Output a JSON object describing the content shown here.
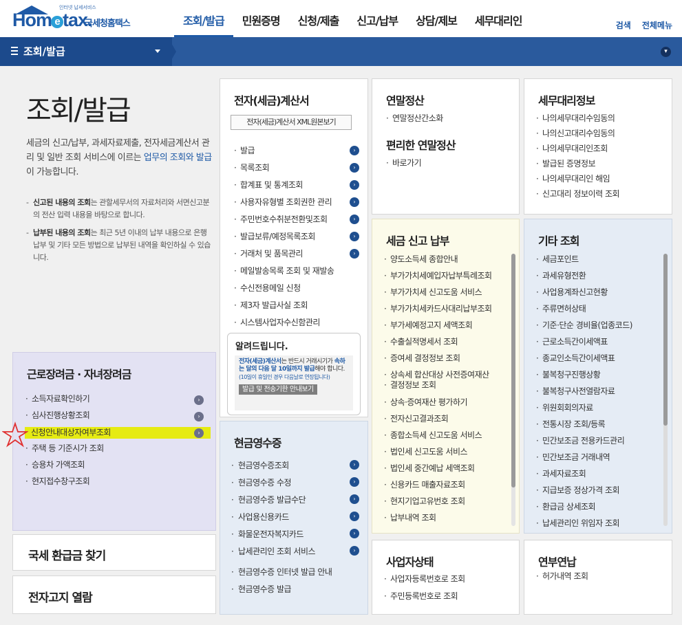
{
  "header": {
    "logo_small": "인터넷 납세서비스",
    "logo_text_a": "Hom",
    "logo_text_e": "e",
    "logo_text_b": "tax.",
    "logo_ko": "국세청홈택스",
    "nav": [
      "조회/발급",
      "민원증명",
      "신청/제출",
      "신고/납부",
      "상담/제보",
      "세무대리인"
    ],
    "util": [
      "검색",
      "전체메뉴"
    ]
  },
  "bar": {
    "menu_label": "조회/발급"
  },
  "intro": {
    "title": "조회/발급",
    "desc_a": "세금의 신고/납부, 과세자료제출, 전자세금계산서 관리 및 일반 조회 서비스에 이르는 ",
    "desc_hl": "업무의 조회와 발급",
    "desc_b": "이 가능합니다.",
    "note1_b": "신고된 내용의 조회",
    "note1": "는 관할세무서의 자료처리와 서면신고분의 전산 입력 내용을 바탕으로 합니다.",
    "note2_b": "납부된 내용의 조회",
    "note2": "는 최근 5년 이내의 납부 내용으로 은행 납부 및 기타 모든 방법으로 납부된 내역을 확인하실 수 있습니다."
  },
  "einvoice": {
    "title": "전자(세금)계산서",
    "xml_button": "전자(세금)계산서 XML원본보기",
    "items": [
      "발급",
      "목록조회",
      "합계표 및 통계조회",
      "사용자유형별 조회권한 관리",
      "주민번호수취분전환및조회",
      "발급보류/예정목록조회",
      "거래처 및 품목관리",
      "메일발송목록 조회 및 재발송",
      "수신전용메일 신청",
      "제3자 발급사실 조회",
      "시스템사업자수신함관리"
    ],
    "notice_title": "알려드립니다.",
    "notice_blue": "전자(세금)계산서",
    "notice_text1": "는 반드시 거래시기가 ",
    "notice_blue2": "속하는 달의 다음 달 10일까지 발급",
    "notice_text2": "해야 합니다.",
    "notice_small": "(10일이 휴일인 경우 다음날로 연장됩니다)",
    "notice_button": "발급 및 전송기한 안내보기"
  },
  "yearend": {
    "title": "연말정산",
    "items": [
      "연말정산간소화"
    ],
    "title2": "편리한 연말정산",
    "items2": [
      "바로가기"
    ]
  },
  "agent": {
    "title": "세무대리정보",
    "items": [
      "나의세무대리수임동의",
      "나의신고대리수임동의",
      "나의세무대리인조회",
      "발급된 증명정보",
      "나의세무대리인 해임",
      "신고대리 정보이력 조회"
    ]
  },
  "taxpay": {
    "title": "세금 신고 납부",
    "items": [
      "양도소득세 종합안내",
      "부가가치세예입자납부특례조회",
      "부가가치세 신고도움 서비스",
      "부가가치세카드사대리납부조회",
      "부가세예정고지 세액조회",
      "수출실적명세서 조회",
      "증여세 결정정보 조회",
      "상속세 합산대상 사전증여재산",
      "결정정보 조회",
      "상속·증여재산 평가하기",
      "전자신고결과조회",
      "종합소득세 신고도움 서비스",
      "법인세 신고도움 서비스",
      "법인세 중간예납 세액조회",
      "신용카드 매출자료조회",
      "현지기업고유번호 조회",
      "납부내역 조회"
    ]
  },
  "other": {
    "title": "기타 조회",
    "items": [
      "세금포인트",
      "과세유형전환",
      "사업용계좌신고현황",
      "주류면허상태",
      "기준·단순 경비율(업종코드)",
      "근로소득간이세액표",
      "종교인소득간이세액표",
      "불복청구진행상황",
      "불복청구사전열람자료",
      "위원회회의자료",
      "전통시장 조회/등록",
      "민간보조금 전용카드관리",
      "민간보조금 거래내역",
      "과세자료조회",
      "지급보증 정상가격 조회",
      "환급금 상세조회",
      "납세관리인 위임자 조회"
    ]
  },
  "eitc": {
    "title": "근로장려금 · 자녀장려금",
    "items": [
      "소득자료확인하기",
      "심사진행상황조회",
      "신청안내대상자여부조회",
      "주택 등 기준시가 조회",
      "승용차 가액조회",
      "현지접수창구조회"
    ]
  },
  "cash": {
    "title": "현금영수증",
    "items": [
      "현금영수증조회",
      "현금영수증 수정",
      "현금영수증 발급수단",
      "사업용신용카드",
      "화물운전자복지카드",
      "납세관리인 조회 서비스",
      "현금영수증 인터넷 발급 안내",
      "현금영수증 발급"
    ]
  },
  "refund": {
    "title": "국세 환급금 찾기"
  },
  "enotice": {
    "title": "전자고지 열람"
  },
  "biz": {
    "title": "사업자상태",
    "items": [
      "사업자등록번호로 조회",
      "주민등록번호로 조회"
    ]
  },
  "pension": {
    "title": "연부연납",
    "items": [
      "허가내역 조회"
    ]
  },
  "colors": {
    "primary": "#1f5aa6",
    "bar": "#2a5a9d",
    "highlight": "#e6eb12",
    "star": "#e03030"
  },
  "icons": [
    "chevron-right-icon",
    "menu-icon",
    "chevron-down-icon",
    "star-mark-icon"
  ]
}
